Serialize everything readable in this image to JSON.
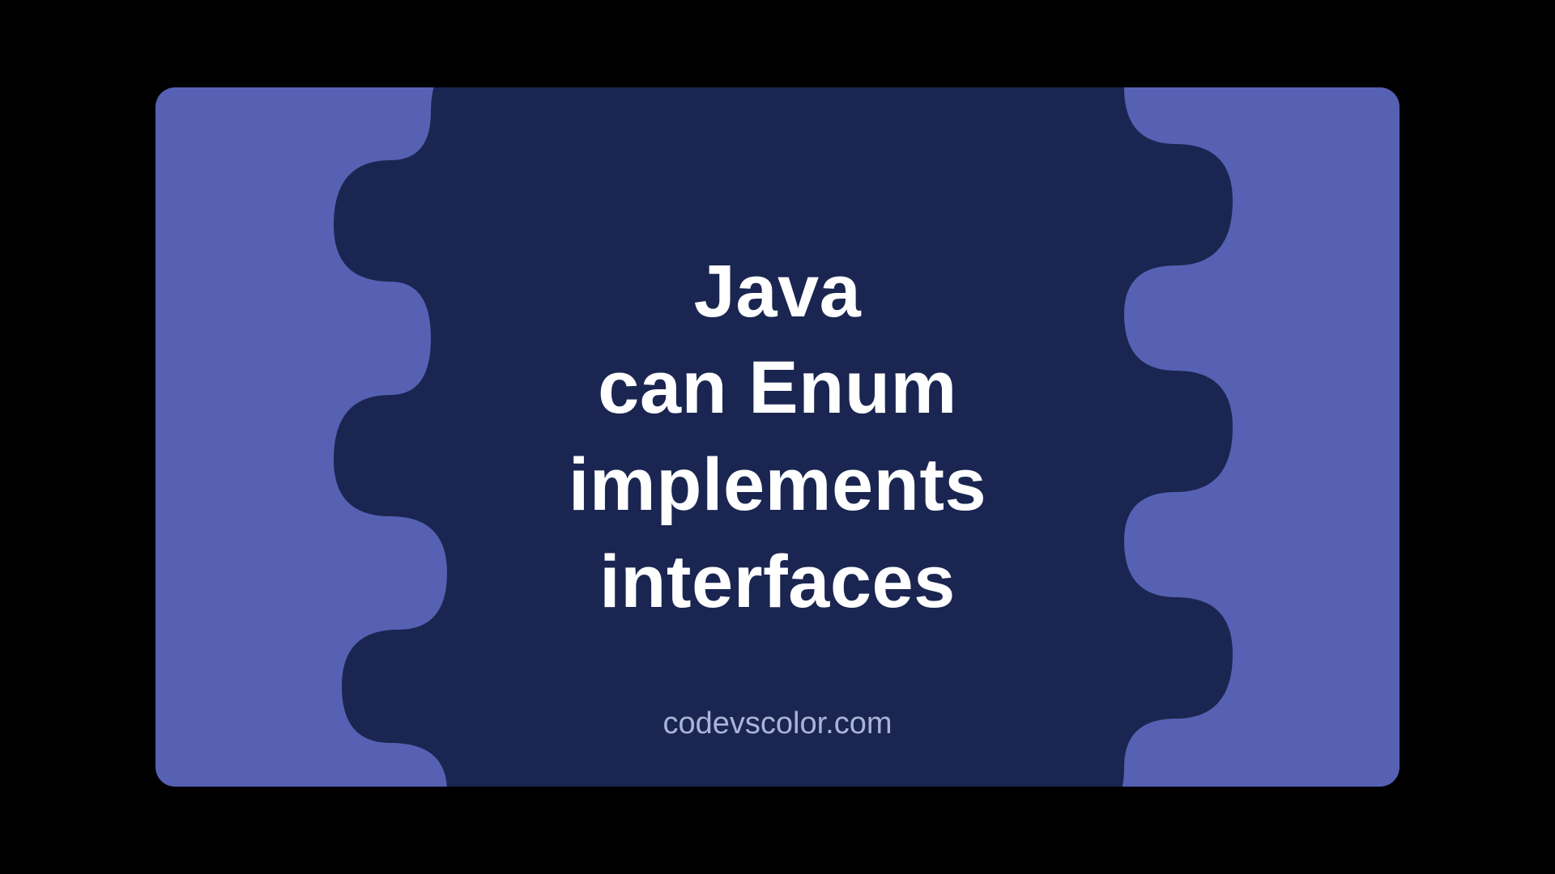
{
  "title_lines": [
    "Java",
    "can Enum",
    "implements",
    "interfaces"
  ],
  "footer": "codevscolor.com",
  "colors": {
    "outer": "#5661b3",
    "inner": "#1a2651",
    "text": "#ffffff",
    "footer": "#a9b4d8"
  }
}
